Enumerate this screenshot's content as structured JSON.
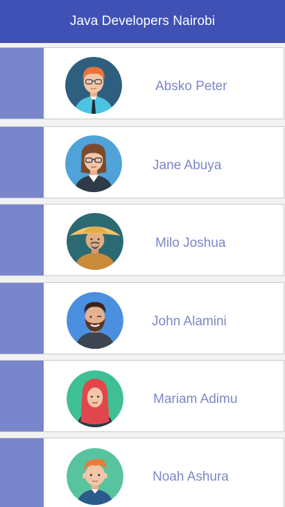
{
  "app_bar": {
    "title": "Java Developers Nairobi"
  },
  "colors": {
    "app_bar": "#3f51b5",
    "accent_strip": "#7986cb",
    "name_text": "#7b86c6",
    "row_background": "#ffffff",
    "row_border": "#c8c8c8"
  },
  "developers": [
    {
      "name": "Absko Peter",
      "avatar_icon": "red-haired-man-glasses-avatar-icon"
    },
    {
      "name": "Jane Abuya",
      "avatar_icon": "woman-glasses-avatar-icon"
    },
    {
      "name": "Milo Joshua",
      "avatar_icon": "man-straw-hat-avatar-icon"
    },
    {
      "name": "John Alamini",
      "avatar_icon": "bearded-man-avatar-icon"
    },
    {
      "name": "Mariam Adimu",
      "avatar_icon": "woman-hijab-avatar-icon"
    },
    {
      "name": "Noah Ashura",
      "avatar_icon": "ginger-boy-avatar-icon"
    }
  ]
}
